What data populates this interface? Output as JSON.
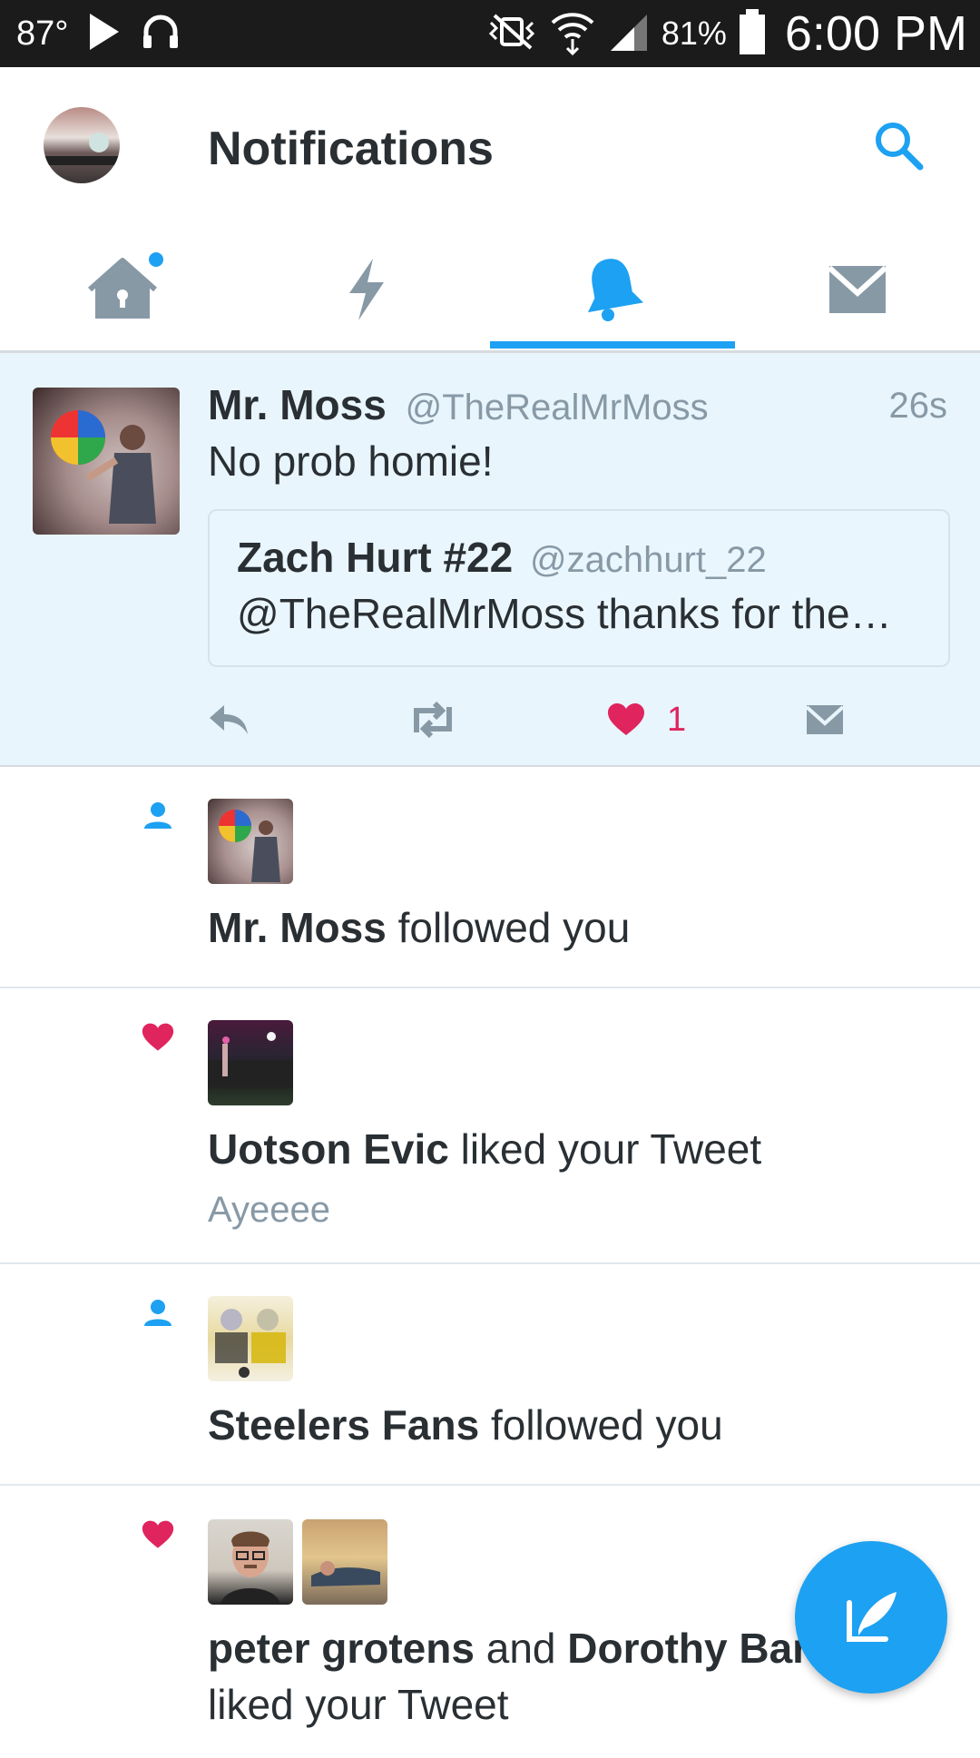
{
  "status_bar": {
    "temperature": "87°",
    "battery_percent": "81%",
    "time": "6:00 PM"
  },
  "header": {
    "title": "Notifications"
  },
  "tabs": [
    {
      "icon": "home-icon",
      "has_dot": true
    },
    {
      "icon": "lightning-icon"
    },
    {
      "icon": "bell-icon",
      "active": true
    },
    {
      "icon": "mail-icon"
    }
  ],
  "tweet": {
    "author_name": "Mr. Moss",
    "author_handle": "@TheRealMrMoss",
    "time": "26s",
    "text": "No prob homie!",
    "quoted": {
      "name": "Zach Hurt #22",
      "handle": "@zachhurt_22",
      "text": "@TheRealMrMoss thanks for the…"
    },
    "like_count": "1"
  },
  "notifications": [
    {
      "type": "follow",
      "name": "Mr. Moss",
      "action": "followed you"
    },
    {
      "type": "like",
      "name": "Uotson Evic",
      "action": "liked your Tweet",
      "tweet_text": "Ayeeee"
    },
    {
      "type": "follow",
      "name": "Steelers Fans",
      "action": "followed you"
    },
    {
      "type": "like",
      "name": "peter grotens",
      "conjunction": "and",
      "name2": "Dorothy Barr",
      "action": "liked your Tweet"
    }
  ],
  "colors": {
    "accent": "#1da1f2",
    "like": "#e0245e",
    "highlight_bg": "#e8f5fd"
  }
}
